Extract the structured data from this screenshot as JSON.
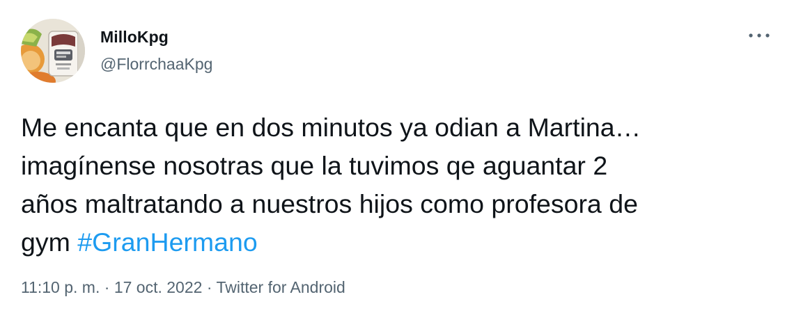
{
  "author": {
    "display_name": "MilloKpg",
    "handle": "@FlorrchaaKpg",
    "avatar_icon": "profile-photo"
  },
  "tweet": {
    "text_before_hashtag": "Me encanta que en dos minutos ya odian a Martina…\nimagínense nosotras que la tuvimos qe aguantar 2\naños maltratando a nuestros hijos como profesora de\ngym ",
    "hashtag": "#GranHermano"
  },
  "meta": {
    "time": "11:10 p. m.",
    "separator": " · ",
    "date": "17 oct. 2022",
    "source": "Twitter for Android"
  },
  "more_button": {
    "icon": "more-dots-icon"
  },
  "colors": {
    "text_primary": "#0f1419",
    "text_secondary": "#536471",
    "accent": "#1d9bf0",
    "background": "#ffffff"
  }
}
